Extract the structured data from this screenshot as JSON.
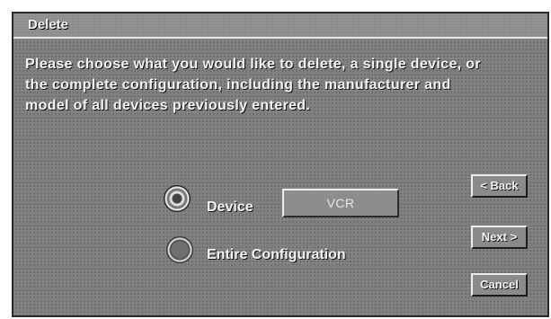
{
  "window": {
    "title": "Delete"
  },
  "description": {
    "line1": "Please choose what you would like to delete, a single device, or",
    "line2": "the complete configuration, including the manufacturer and",
    "line3": "model of all devices previously entered."
  },
  "options": {
    "device": {
      "label": "Device",
      "selected": true,
      "value": "VCR"
    },
    "entire_configuration": {
      "label": "Entire Configuration",
      "selected": false
    }
  },
  "buttons": {
    "back": "< Back",
    "next": "Next >",
    "cancel": "Cancel"
  }
}
